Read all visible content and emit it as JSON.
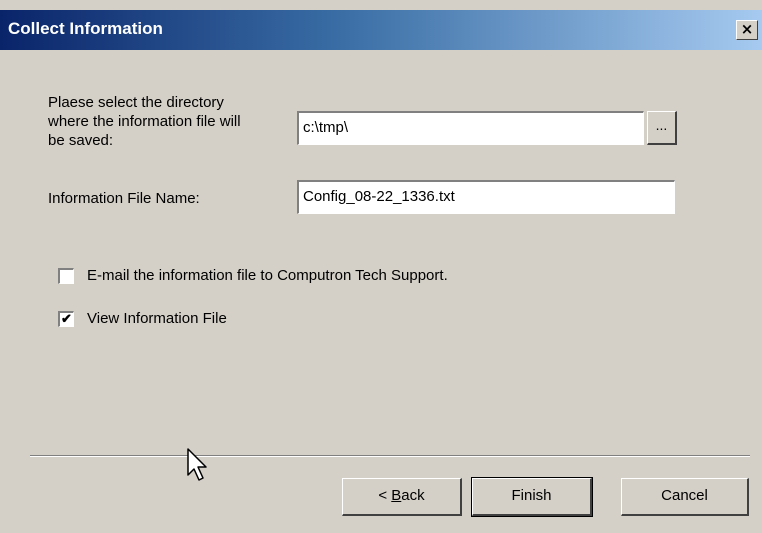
{
  "window": {
    "title": "Collect Information",
    "close_label": "×"
  },
  "directory": {
    "label_lines": [
      "Plaese select the directory",
      "where the information file will",
      "be saved:"
    ],
    "value": "c:\\tmp\\",
    "browse_label": "..."
  },
  "filename": {
    "label": "Information File Name:",
    "value": "Config_08-22_1336.txt"
  },
  "options": {
    "email": {
      "label": "E-mail the information file to Computron Tech Support.",
      "checked": false
    },
    "view": {
      "label": "View Information File",
      "checked": true,
      "mark": "✔"
    }
  },
  "buttons": {
    "back_prefix": "< ",
    "back_accel": "B",
    "back_rest": "ack",
    "finish": "Finish",
    "cancel": "Cancel"
  }
}
